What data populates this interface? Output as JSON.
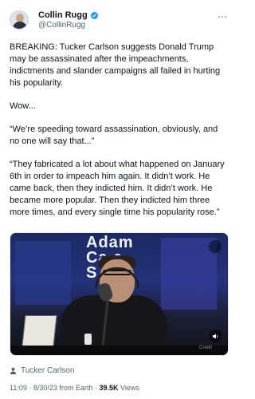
{
  "author": {
    "display_name": "Collin Rugg",
    "handle": "@CollinRugg",
    "verified": true,
    "verified_color": "#1d9bf0"
  },
  "header": {
    "more_icon": "more-dots-icon"
  },
  "tweet": {
    "paragraphs": [
      "BREAKING: Tucker Carlson suggests Donald Trump may be assassinated after the impeachments, indictments and slander campaigns all failed in hurting his popularity.",
      "Wow...",
      "“We’re speeding toward assassination, obviously, and no one will say that...”",
      "“They fabricated a lot about what happened on January 6th in order to impeach him again. It didn’t work. He came back, then they indicted him. It didn’t work. He became more popular. Then they indicted him three more times, and every single time his popularity rose.”"
    ]
  },
  "media": {
    "sign_line1": "Adam",
    "sign_line2": "Ca  a",
    "sign_line3": "S",
    "watermark": "Credit"
  },
  "tagged": {
    "icon": "person-icon",
    "name": "Tucker Carlson"
  },
  "meta": {
    "time": "11:09",
    "separator": "·",
    "date": "8/30/23",
    "source": "from Earth",
    "views_count": "39.5K",
    "views_label": "Views"
  }
}
